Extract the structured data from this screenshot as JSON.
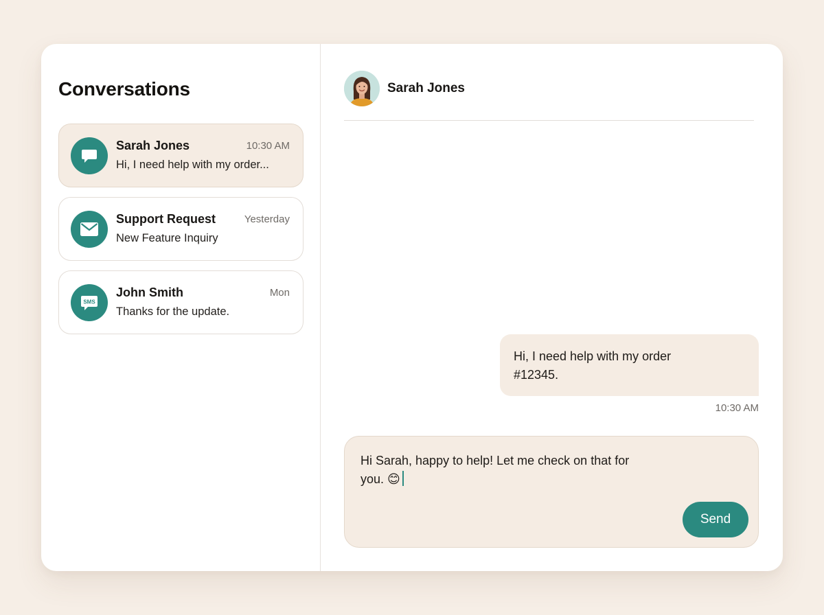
{
  "sidebar": {
    "title": "Conversations",
    "conversations": [
      {
        "name": "Sarah Jones",
        "time": "10:30 AM",
        "preview": "Hi, I need help with my order...",
        "icon": "chat-bubble-icon",
        "active": true
      },
      {
        "name": "Support Request",
        "time": "Yesterday",
        "preview": "New Feature Inquiry",
        "icon": "envelope-icon",
        "active": false
      },
      {
        "name": "John Smith",
        "time": "Mon",
        "preview": "Thanks for the update.",
        "icon": "sms-icon",
        "icon_text": "SMS",
        "active": false
      }
    ]
  },
  "chat": {
    "contact_name": "Sarah Jones",
    "avatar_icon": "user-photo-avatar",
    "messages": [
      {
        "text_line1": "Hi, I need help with my order",
        "text_line2": "#12345.",
        "time": "10:30 AM"
      }
    ],
    "composer": {
      "draft_line1": "Hi Sarah, happy to help! Let me check on that for",
      "draft_line2": "you. 😊",
      "send_label": "Send"
    }
  },
  "colors": {
    "accent": "#2b8a80",
    "background": "#f6eee6",
    "bubble": "#f5ece3",
    "panel": "#ffffff"
  }
}
